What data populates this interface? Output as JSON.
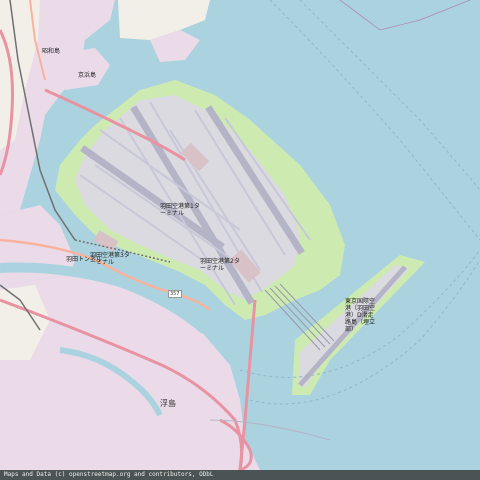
{
  "map": {
    "colors": {
      "water": "#aad3df",
      "land": "#f2efe9",
      "industrial": "#ebdbe8",
      "grass": "#cdebb0",
      "apron": "#dadae0",
      "runway": "#bbbbcc",
      "taxiway": "#c8c8d4",
      "motorway": "#e892a2",
      "trunk": "#f9b29c",
      "rail": "#707070",
      "boundary": "#b08ab0"
    },
    "labels": {
      "airport_terminal_3": "羽田空港第3ターミナル",
      "airport_terminal_1": "羽田空港第1ターミナル",
      "airport_terminal_2": "羽田空港第2ターミナル",
      "new_runway": "東京国際空港（羽田空港）D滑走路島（埋立部）",
      "ukishima": "浮島",
      "route_357": "357",
      "keihinjima": "京浜島",
      "showajima": "昭和島",
      "haneda_tunnel": "羽田トンネル"
    },
    "attribution": "Maps and Data (c) openstreetmap.org and contributors, ODbL"
  }
}
